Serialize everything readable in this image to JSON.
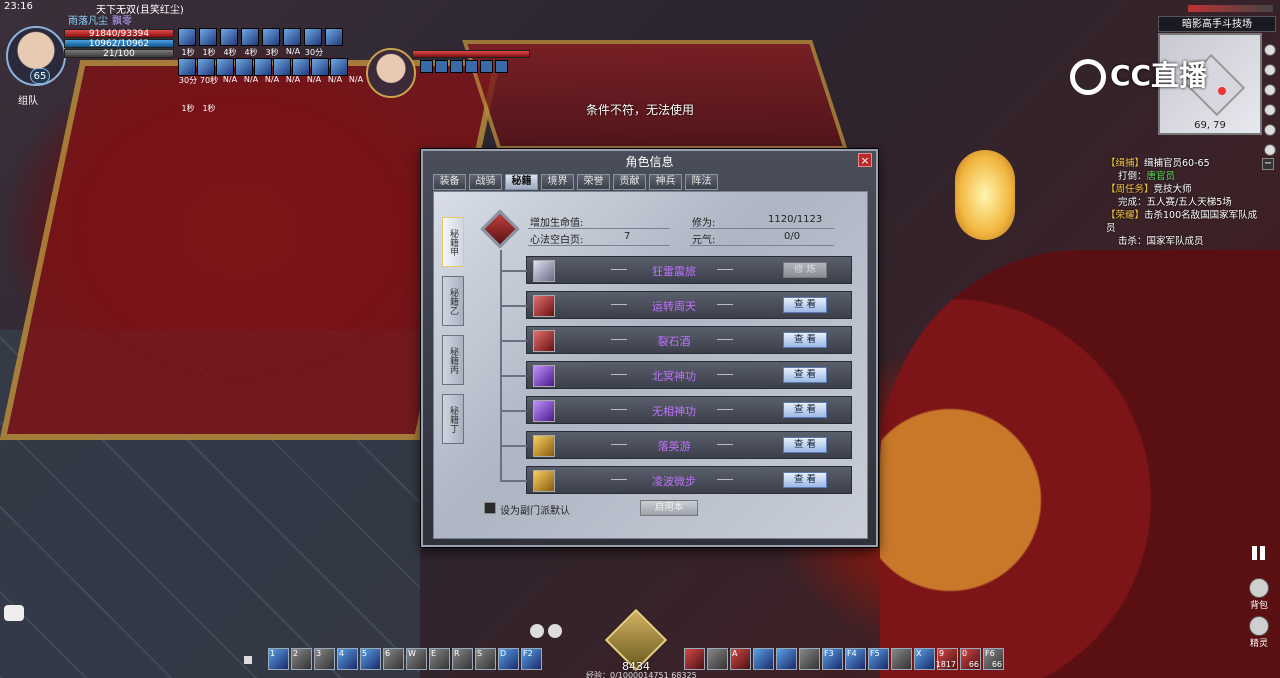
{
  "hud": {
    "time": "23:16",
    "tagline": "天下无双(且笑红尘)",
    "name_a": "雨落凡尘",
    "name_b": "飘零",
    "level": "65",
    "team_label": "组队",
    "hp": "91840/93394",
    "mp": "10962/10962",
    "energy": "21/100",
    "buff_times_row1": [
      "1秒",
      "1秒",
      "4秒",
      "4秒",
      "3秒",
      "N/A",
      "30分"
    ],
    "buff_times_row2": [
      "30分",
      "70秒",
      "N/A",
      "N/A",
      "N/A",
      "N/A",
      "N/A",
      "N/A",
      "N/A"
    ],
    "buff_times_row3": [
      "1秒",
      "1秒"
    ]
  },
  "system_message": "条件不符，无法使用",
  "minimap": {
    "title": "暗影高手斗技场",
    "coords": "69, 79"
  },
  "brand": "CC直播",
  "quests": [
    {
      "cat": "【缉捕】",
      "text": "缉捕官员60-65"
    },
    {
      "indent": true,
      "text": "打倒：",
      "hl": "唐官员"
    },
    {
      "cat": "【周任务】",
      "text": "竞技大师"
    },
    {
      "indent": true,
      "text": "完成：五人赛/五人天梯5场"
    },
    {
      "cat": "【荣耀】",
      "text": "击杀100名敌国国家军队成员"
    },
    {
      "indent": true,
      "text": "击杀：国家军队成员"
    }
  ],
  "right_buttons": {
    "bag": "背包",
    "sprite": "精灵"
  },
  "bottom": {
    "orb_value": "8434",
    "exp_text": "经验：0/1000014751 68325",
    "skill_keys_left": [
      "1",
      "2",
      "3",
      "4",
      "5",
      "6",
      "W",
      "E",
      "R",
      "S",
      "D",
      "F2"
    ],
    "skill_keys_right": [
      "A",
      "F3",
      "F4",
      "F5",
      "X",
      "9",
      "0",
      "F6"
    ],
    "counts_right": [
      "1817",
      "66",
      "66"
    ]
  },
  "dialog": {
    "title": "角色信息",
    "tabs": [
      "装备",
      "战骑",
      "秘籍",
      "境界",
      "荣誉",
      "贡献",
      "神兵",
      "阵法"
    ],
    "active_tab": "秘籍",
    "side_tabs": [
      "秘籍甲",
      "秘籍乙",
      "秘籍丙",
      "秘籍丁"
    ],
    "stats": {
      "life_label": "增加生命值:",
      "life_value": "",
      "blank_label": "心法空白页:",
      "blank_value": "7",
      "cultivation_label": "修为:",
      "cultivation_value": "1120/1123",
      "yuanqi_label": "元气:",
      "yuanqi_value": "0/0"
    },
    "rows": [
      {
        "name": "狂雷震旅",
        "button": "修 炼",
        "disabled": true
      },
      {
        "name": "运转周天",
        "button": "查 看"
      },
      {
        "name": "裂石酒",
        "button": "查 看"
      },
      {
        "name": "北冥神功",
        "button": "查 看"
      },
      {
        "name": "无相神功",
        "button": "查 看"
      },
      {
        "name": "落英游",
        "button": "查 看"
      },
      {
        "name": "凌波微步",
        "button": "查 看"
      }
    ],
    "default_checkbox": "设为副门派默认",
    "use_button": "启用本"
  }
}
